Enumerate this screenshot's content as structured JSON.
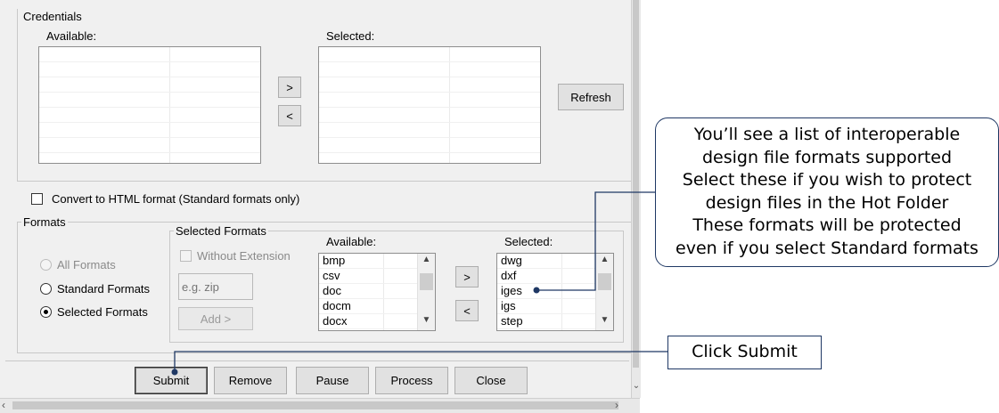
{
  "credentials": {
    "legend": "Credentials",
    "available_label": "Available:",
    "selected_label": "Selected:",
    "move_right": ">",
    "move_left": "<",
    "refresh": "Refresh"
  },
  "convert_html": {
    "label": "Convert to HTML format (Standard formats only)",
    "checked": false
  },
  "formats": {
    "legend": "Formats",
    "radio_all": "All Formats",
    "radio_standard": "Standard Formats",
    "radio_selected": "Selected Formats",
    "selected_option": "Selected Formats"
  },
  "selected_formats": {
    "legend": "Selected Formats",
    "without_extension": "Without Extension",
    "ext_placeholder": "e.g. zip",
    "add_button": "Add >",
    "available_label": "Available:",
    "selected_label": "Selected:",
    "move_right": ">",
    "move_left": "<",
    "available_items": [
      "bmp",
      "csv",
      "doc",
      "docm",
      "docx"
    ],
    "selected_items": [
      "dwg",
      "dxf",
      "iges",
      "igs",
      "step"
    ]
  },
  "bottom_buttons": {
    "submit": "Submit",
    "remove": "Remove",
    "pause": "Pause",
    "process": "Process",
    "close": "Close"
  },
  "callouts": {
    "formats_lines": [
      "You’ll see a list of interoperable",
      "design file formats supported",
      "Select these if you wish to protect",
      "design files in the Hot Folder",
      "These formats will be protected",
      "even if you select Standard formats"
    ],
    "submit_text": "Click Submit",
    "border_color": "#1f3864"
  },
  "icons": {
    "scroll_up": "▲",
    "scroll_down": "▼"
  }
}
